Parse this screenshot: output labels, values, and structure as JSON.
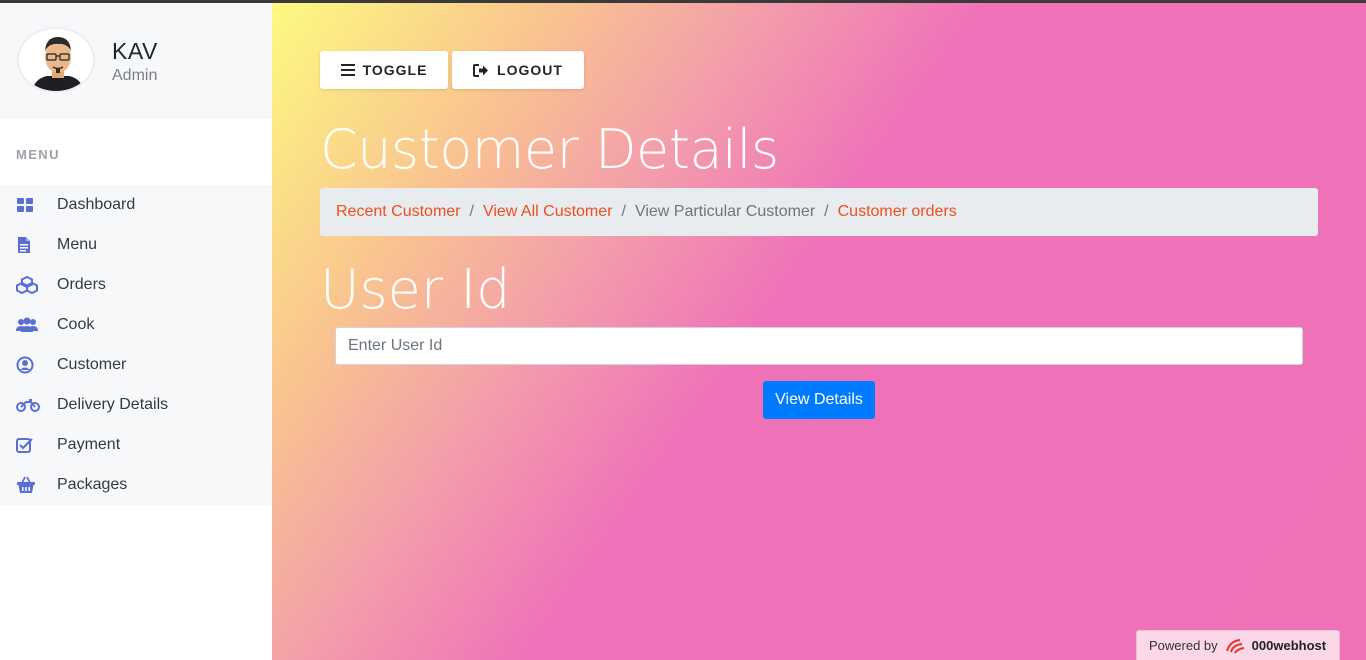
{
  "profile": {
    "name": "KAV",
    "role": "Admin"
  },
  "menu": {
    "heading": "MENU",
    "items": [
      {
        "label": "Dashboard",
        "icon": "dashboard-icon"
      },
      {
        "label": "Menu",
        "icon": "document-icon"
      },
      {
        "label": "Orders",
        "icon": "cubes-icon"
      },
      {
        "label": "Cook",
        "icon": "users-icon"
      },
      {
        "label": "Customer",
        "icon": "user-circle-icon"
      },
      {
        "label": "Delivery Details",
        "icon": "motorcycle-icon"
      },
      {
        "label": "Payment",
        "icon": "check-square-icon"
      },
      {
        "label": "Packages",
        "icon": "basket-icon"
      }
    ]
  },
  "toolbar": {
    "toggle_label": "TOGGLE",
    "logout_label": "LOGOUT"
  },
  "page": {
    "title": "Customer Details"
  },
  "breadcrumb": {
    "items": [
      "Recent Customer",
      "View All Customer",
      "View Particular Customer",
      "Customer orders"
    ],
    "separator": "/"
  },
  "form": {
    "title": "User Id",
    "input_placeholder": "Enter User Id",
    "submit_label": "View Details"
  },
  "footer": {
    "powered_label": "Powered by",
    "brand": "000webhost"
  },
  "colors": {
    "accent_icon": "#5a6fd6",
    "link": "#f04e1e",
    "primary_button": "#007bff"
  }
}
